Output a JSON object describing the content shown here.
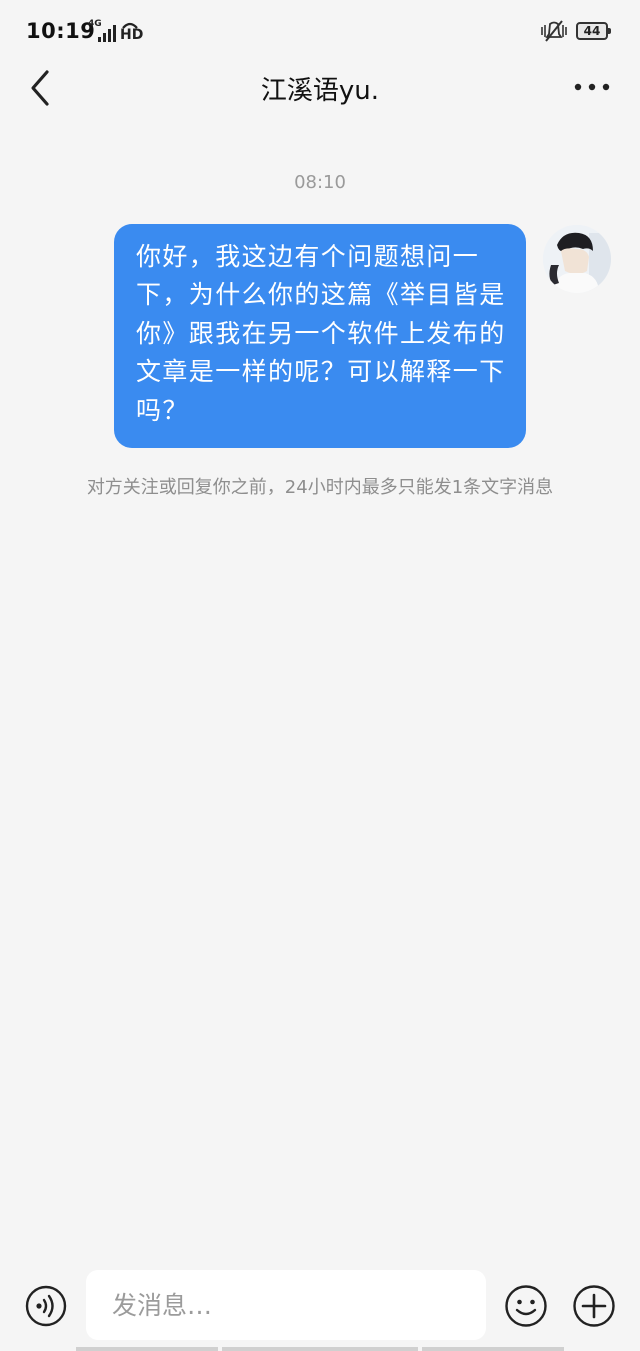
{
  "status_bar": {
    "time": "10:19",
    "network": "4G",
    "hd": "HD",
    "battery": "44"
  },
  "header": {
    "title": "江溪语yu."
  },
  "chat": {
    "timestamp": "08:10",
    "messages": [
      {
        "sender": "me",
        "text": "你好，我这边有个问题想问一下，为什么你的这篇《举目皆是你》跟我在另一个软件上发布的文章是一样的呢？可以解释一下吗？"
      }
    ],
    "notice": "对方关注或回复你之前，24小时内最多只能发1条文字消息",
    "bubble_color": "#3a8bf0"
  },
  "input_bar": {
    "placeholder": "发消息…"
  },
  "icons": {
    "back": "back-chevron-icon",
    "more": "more-dots-icon",
    "voice": "voice-icon",
    "emoji": "emoji-icon",
    "add": "plus-icon"
  }
}
